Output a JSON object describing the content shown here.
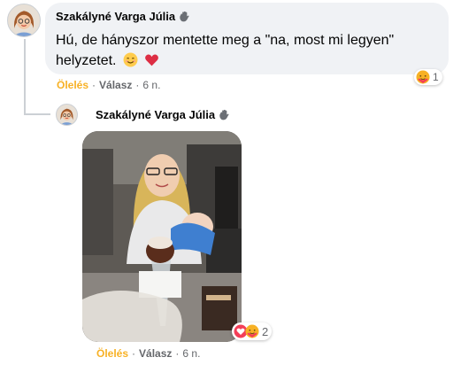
{
  "comment": {
    "author": "Szakályné Varga Júlia",
    "text": "Hú, de hányszor mentette meg a \"na, most mi legyen\" helyzetet.",
    "emojis": [
      "smiling-face-icon",
      "red-heart-icon"
    ],
    "reaction_count": "1",
    "actions": {
      "like": "Ölelés",
      "reply": "Válasz",
      "time": "6 n."
    }
  },
  "reply": {
    "author": "Szakályné Varga Júlia",
    "reaction_count": "2",
    "actions": {
      "like": "Ölelés",
      "reply": "Válasz",
      "time": "6 n."
    }
  },
  "colors": {
    "bubble": "#f0f2f5",
    "hug_reaction_label": "#f7b125",
    "secondary_text": "#65676b",
    "heart_reaction": "#f33e58"
  }
}
